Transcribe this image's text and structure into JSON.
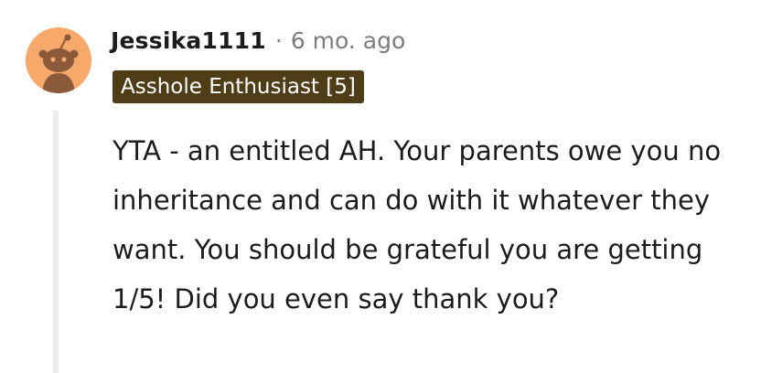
{
  "comment": {
    "username": "Jessika1111",
    "separator": "·",
    "timestamp": "6 mo. ago",
    "flair": "Asshole Enthusiast [5]",
    "flair_color": "#4f3d17",
    "avatar_icon": "snoo-avatar-icon",
    "avatar_color": "#f6a96b",
    "body": "YTA - an entitled AH. Your parents owe you no inheritance and can do with it whatever they want. You should be grateful you are getting 1/5! Did you even say thank you?"
  }
}
